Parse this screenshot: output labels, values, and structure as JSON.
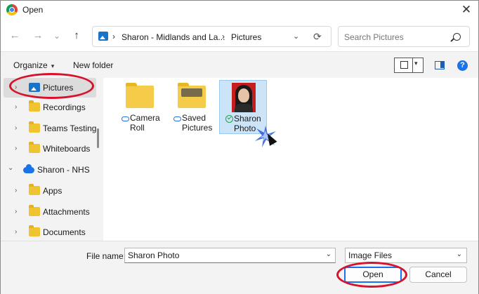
{
  "window": {
    "title": "Open",
    "close_glyph": "✕"
  },
  "nav": {
    "back_glyph": "←",
    "forward_glyph": "→",
    "recent_glyph": "⌄",
    "up_glyph": "↑"
  },
  "address": {
    "segments": [
      "Sharon - Midlands and La...",
      "Pictures"
    ],
    "separator": "›",
    "dropdown_glyph": "⌄",
    "refresh_glyph": "⟳"
  },
  "search": {
    "placeholder": "Search Pictures"
  },
  "toolbar": {
    "organize_label": "Organize",
    "organize_caret": "▾",
    "new_folder_label": "New folder",
    "view_caret": "▾",
    "help_glyph": "?"
  },
  "sidebar": {
    "items": [
      {
        "label": "Pictures",
        "icon": "pictures-icon",
        "selected": true
      },
      {
        "label": "Recordings",
        "icon": "folder-icon"
      },
      {
        "label": "Teams Testing",
        "icon": "folder-icon"
      },
      {
        "label": "Whiteboards",
        "icon": "folder-icon"
      },
      {
        "label": "Sharon - NHS",
        "icon": "onedrive-cloud-icon",
        "expanded": true
      },
      {
        "label": "Apps",
        "icon": "folder-icon"
      },
      {
        "label": "Attachments",
        "icon": "folder-icon"
      },
      {
        "label": "Documents",
        "icon": "folder-icon"
      }
    ],
    "chevron_right": "›",
    "chevron_down": "⌄"
  },
  "files": [
    {
      "line1": "Camera",
      "line2": "Roll",
      "type": "folder",
      "status": "cloud-icon"
    },
    {
      "line1": "Saved",
      "line2": "Pictures",
      "type": "folder",
      "status": "cloud-icon"
    },
    {
      "line1": "Sharon",
      "line2": "Photo",
      "type": "image",
      "status": "synced-check-icon",
      "selected": true
    }
  ],
  "footer": {
    "file_name_label": "File name:",
    "file_name_value": "Sharon Photo",
    "file_type_value": "Image Files",
    "caret": "⌄",
    "open_label": "Open",
    "cancel_label": "Cancel"
  },
  "colors": {
    "annotation": "#d9122b",
    "accent": "#1a73e8",
    "selection": "#cce4f7"
  }
}
